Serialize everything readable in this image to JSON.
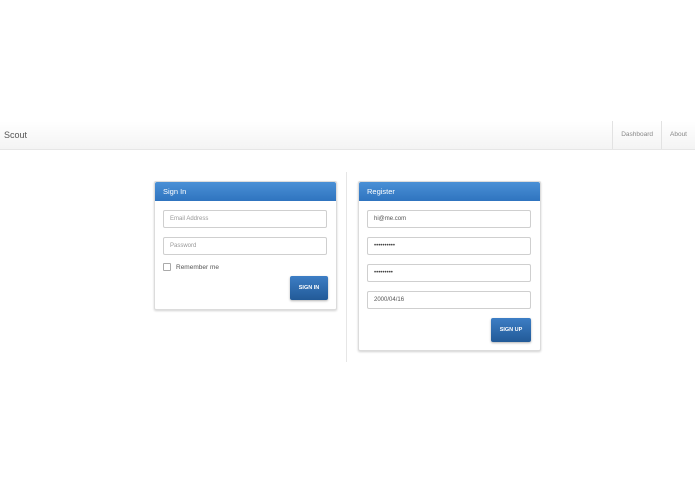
{
  "navbar": {
    "brand": "Scout",
    "links": [
      "Dashboard",
      "About"
    ]
  },
  "signin": {
    "title": "Sign In",
    "email_placeholder": "Email Address",
    "password_placeholder": "Password",
    "remember_label": "Remember me",
    "remember_checked": false,
    "button_label": "SIGN IN"
  },
  "register": {
    "title": "Register",
    "email_value": "hi@me.com",
    "password_value": "••••••••••",
    "confirm_value": "•••••••••",
    "birthdate_value": "2000/04/16",
    "button_label": "SIGN UP"
  },
  "colors": {
    "panel_header": "#3a82cc",
    "button": "#2c69ad"
  }
}
